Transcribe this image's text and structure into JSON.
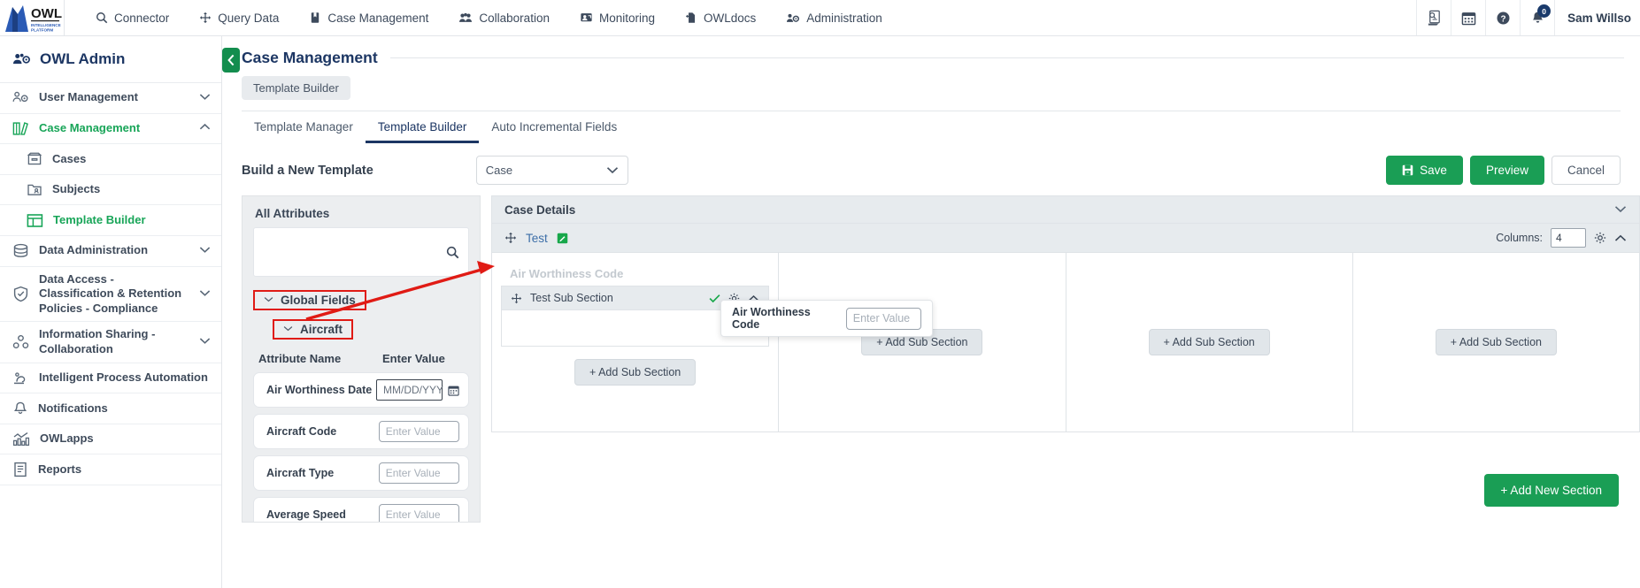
{
  "topnav": {
    "brand_name": "OWL",
    "brand_sub1": "INTELLIGENCE",
    "brand_sub2": "PLATFORM",
    "items": [
      {
        "label": "Connector",
        "icon": "search-icon"
      },
      {
        "label": "Query Data",
        "icon": "move-arrows-icon"
      },
      {
        "label": "Case Management",
        "icon": "book-icon"
      },
      {
        "label": "Collaboration",
        "icon": "people-icon"
      },
      {
        "label": "Monitoring",
        "icon": "monitor-icon"
      },
      {
        "label": "OWLdocs",
        "icon": "doc-share-icon"
      },
      {
        "label": "Administration",
        "icon": "admin-gear-icon"
      }
    ],
    "right_icons": [
      {
        "name": "audit-log-icon"
      },
      {
        "name": "calendar-icon"
      },
      {
        "name": "help-icon"
      },
      {
        "name": "bell-icon"
      }
    ],
    "notification_count": "0",
    "user_name": "Sam Willso"
  },
  "sidebar": {
    "title": "OWL Admin",
    "items": [
      {
        "label": "User Management",
        "icon": "user-gear-icon",
        "chevron": "down",
        "active": false,
        "sub": false
      },
      {
        "label": "Case Management",
        "icon": "books-icon",
        "chevron": "up",
        "active": true,
        "sub": false
      },
      {
        "label": "Cases",
        "icon": "case-box-icon",
        "chevron": "",
        "active": false,
        "sub": true
      },
      {
        "label": "Subjects",
        "icon": "folder-user-icon",
        "chevron": "",
        "active": false,
        "sub": true
      },
      {
        "label": "Template Builder",
        "icon": "layout-icon",
        "chevron": "",
        "active": true,
        "sub": true
      },
      {
        "label": "Data Administration",
        "icon": "database-icon",
        "chevron": "down",
        "active": false,
        "sub": false
      },
      {
        "label": "Data Access - Classification & Retention Policies - Compliance",
        "icon": "shield-check-icon",
        "chevron": "down",
        "active": false,
        "sub": false
      },
      {
        "label": "Information Sharing - Collaboration",
        "icon": "share-nodes-icon",
        "chevron": "down",
        "active": false,
        "sub": false
      },
      {
        "label": "Intelligent Process Automation",
        "icon": "automation-icon",
        "chevron": "",
        "active": false,
        "sub": false
      },
      {
        "label": "Notifications",
        "icon": "bell-icon",
        "chevron": "",
        "active": false,
        "sub": false
      },
      {
        "label": "OWLapps",
        "icon": "apps-chart-icon",
        "chevron": "",
        "active": false,
        "sub": false
      },
      {
        "label": "Reports",
        "icon": "report-icon",
        "chevron": "",
        "active": false,
        "sub": false
      }
    ]
  },
  "main": {
    "page_title": "Case Management",
    "breadcrumb": "Template Builder",
    "tabs": [
      {
        "label": "Template Manager",
        "active": false
      },
      {
        "label": "Template Builder",
        "active": true
      },
      {
        "label": "Auto Incremental Fields",
        "active": false
      }
    ],
    "build_title": "Build a New Template",
    "type_select_value": "Case",
    "buttons": {
      "save": "Save",
      "preview": "Preview",
      "cancel": "Cancel"
    }
  },
  "attributes_panel": {
    "heading": "All Attributes",
    "search_placeholder": "",
    "groups": [
      {
        "label": "Global Fields",
        "expanded": true
      },
      {
        "label": "Aircraft",
        "expanded": true
      }
    ],
    "column_headers": {
      "name": "Attribute Name",
      "value": "Enter Value"
    },
    "rows": [
      {
        "name": "Air Worthiness Date",
        "placeholder": "MM/DD/YYY",
        "type": "date"
      },
      {
        "name": "Aircraft Code",
        "placeholder": "Enter Value",
        "type": "text"
      },
      {
        "name": "Aircraft Type",
        "placeholder": "Enter Value",
        "type": "text"
      },
      {
        "name": "Average Speed",
        "placeholder": "Enter Value",
        "type": "text"
      }
    ]
  },
  "builder": {
    "section_title": "Case Details",
    "sub_section_name": "Test",
    "columns_label": "Columns:",
    "columns_value": "4",
    "ghost_field_label": "Air Worthiness Code",
    "nested_section_name": "Test Sub Section",
    "add_sub_section_label": "+ Add Sub Section",
    "add_new_section_label": "+ Add New Section",
    "add_sub_buttons": [
      "+ Add Sub Section",
      "+ Add Sub Section",
      "+ Add Sub Section",
      "+ Add Sub Section"
    ]
  },
  "popup_card": {
    "label": "Air Worthiness Code",
    "input_placeholder": "Enter Value"
  },
  "colors": {
    "accent_green": "#1a9e55",
    "brand_navy": "#1c3663",
    "annotation_red": "#e01b15"
  }
}
